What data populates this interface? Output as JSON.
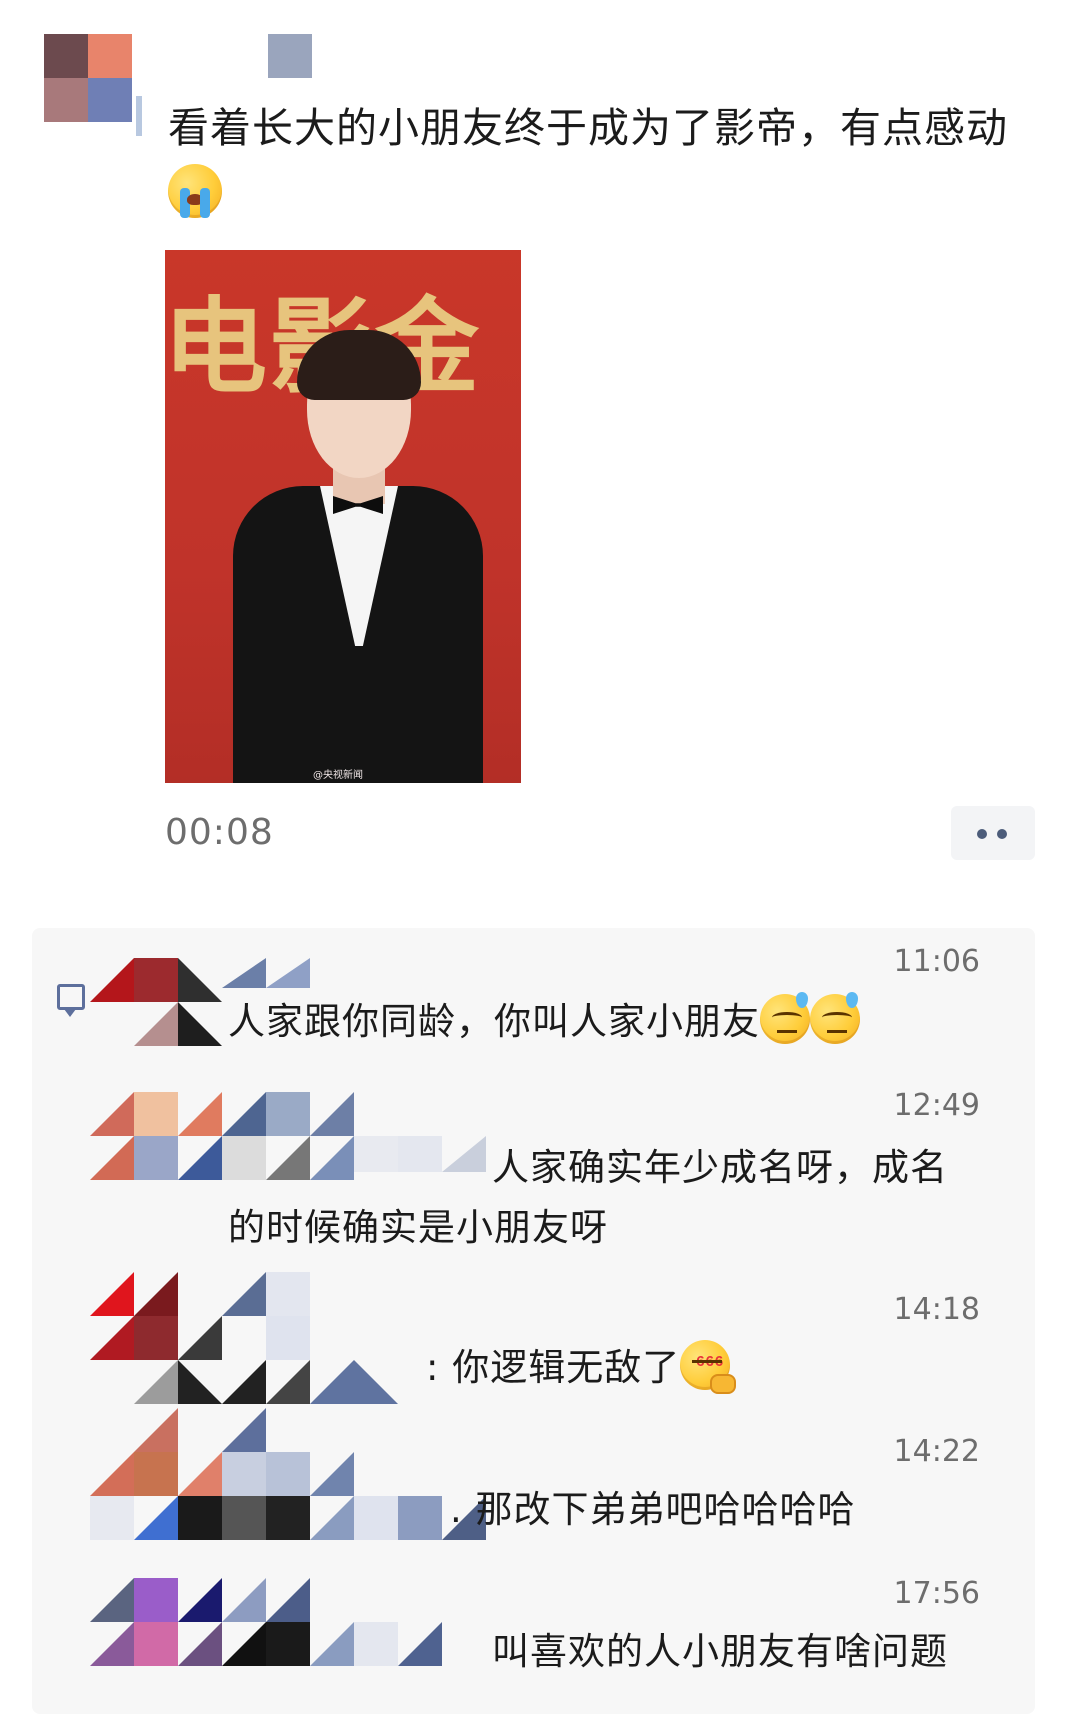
{
  "post": {
    "text": "看着长大的小朋友终于成为了影帝，有点感动",
    "emoji": "loudly-crying-face",
    "photo": {
      "banner_text": "电影金",
      "watermark": "@央视新闻"
    },
    "time": "00:08",
    "more_icon": "two-dots-icon"
  },
  "comments": [
    {
      "time": "11:06",
      "text": "人家跟你同龄，你叫人家小朋友",
      "emojis": [
        "sweat-face",
        "sweat-face"
      ]
    },
    {
      "time": "12:49",
      "text": "人家确实年少成名呀，成名的时候确实是小朋友呀",
      "line1": "人家确实年少成名呀，成名",
      "line2": "的时候确实是小朋友呀"
    },
    {
      "time": "14:18",
      "text": "你逻辑无敌了",
      "prefix": ":",
      "emojis": [
        "thinking-666-face"
      ]
    },
    {
      "time": "14:22",
      "text": "那改下弟弟吧哈哈哈哈",
      "prefix": "."
    },
    {
      "time": "17:56",
      "text": "叫喜欢的人小朋友有啥问题"
    }
  ],
  "colors": {
    "page_bg": "#ffffff",
    "comment_bg": "#f7f7f7",
    "accent": "#5d6f9c",
    "text": "#1b1b1b",
    "muted": "#6d6d6d"
  }
}
